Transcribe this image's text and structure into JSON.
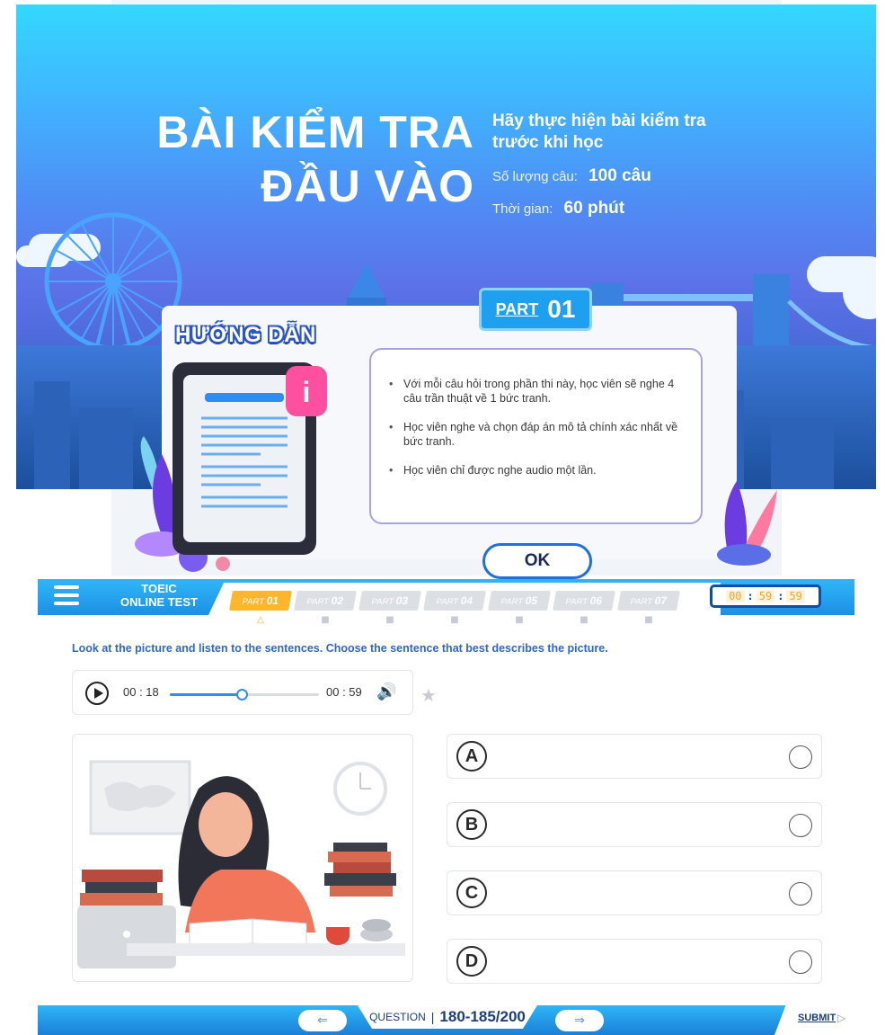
{
  "hero": {
    "title_line1": "BÀI KIỂM TRA",
    "title_line2": "ĐẦU VÀO",
    "lead": "Hãy thực hiện bài kiểm tra trước khi học",
    "count_label": "Số lượng câu:",
    "count_value": "100 câu",
    "time_label": "Thời gian:",
    "time_value": "60 phút"
  },
  "guide": {
    "title": "HƯỚNG DẪN",
    "part_label": "PART",
    "part_number": "01",
    "instructions": [
      "Với mỗi câu hỏi trong phần thi này, học viên sẽ nghe 4 câu trần thuật về 1 bức tranh.",
      "Học viên nghe và chọn đáp án mô tả chính xác nhất về bức tranh.",
      "Học viên chỉ được nghe audio một lần."
    ],
    "ok_label": "OK"
  },
  "app": {
    "brand_line1": "TOEIC",
    "brand_line2": "ONLINE TEST",
    "tabs": [
      {
        "label": "PART",
        "num": "01"
      },
      {
        "label": "PART",
        "num": "02"
      },
      {
        "label": "PART",
        "num": "03"
      },
      {
        "label": "PART",
        "num": "04"
      },
      {
        "label": "PART",
        "num": "05"
      },
      {
        "label": "PART",
        "num": "06"
      },
      {
        "label": "PART",
        "num": "07"
      }
    ],
    "active_tab": 0,
    "timer": {
      "h": "00",
      "m": "59",
      "s": "59"
    },
    "instruction": "Look at the picture and listen to the sentences. Choose the sentence that best describes the picture.",
    "player": {
      "current": "00 : 18",
      "duration": "00 : 59",
      "progress": 0.49
    },
    "options": [
      "A",
      "B",
      "C",
      "D"
    ],
    "question_label": "QUESTION",
    "question_range": "180-185/200",
    "prev_icon": "arrow-left-icon",
    "next_icon": "arrow-right-icon",
    "submit_label": "SUBMIT"
  },
  "colors": {
    "primary": "#1f8fe6",
    "accent": "#ffb52e",
    "instruction_text": "#2f68c6"
  }
}
